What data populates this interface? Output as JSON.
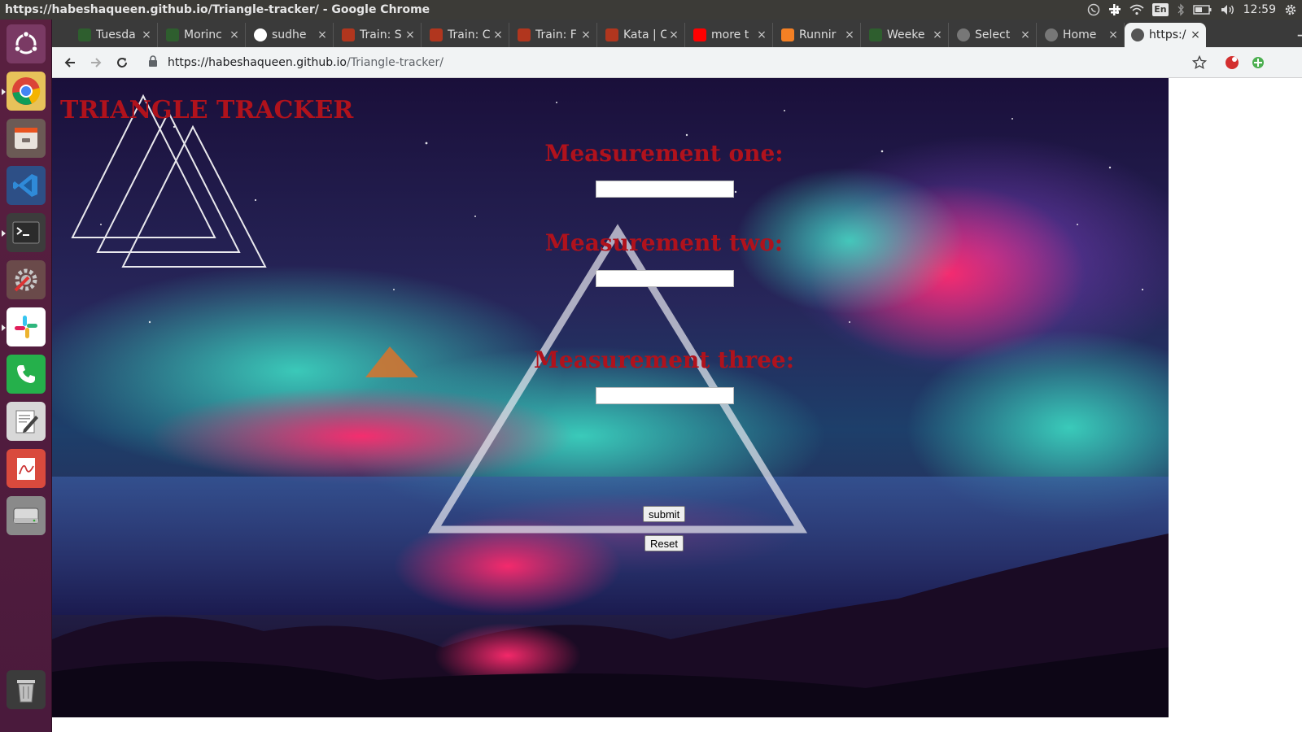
{
  "window": {
    "title": "https://habeshaqueen.github.io/Triangle-tracker/ - Google Chrome",
    "clock": "12:59",
    "keyboard_layout": "En"
  },
  "launcher": [
    {
      "name": "ubuntu-dash",
      "icon": "ubuntu-logo-icon"
    },
    {
      "name": "chrome",
      "icon": "chrome-icon"
    },
    {
      "name": "files",
      "icon": "files-icon"
    },
    {
      "name": "vscode",
      "icon": "vscode-icon"
    },
    {
      "name": "terminal",
      "icon": "terminal-icon"
    },
    {
      "name": "system-settings",
      "icon": "settings-icon"
    },
    {
      "name": "slack",
      "icon": "slack-icon"
    },
    {
      "name": "phone",
      "icon": "phone-icon"
    },
    {
      "name": "text-editor",
      "icon": "text-editor-icon"
    },
    {
      "name": "pdf-reader",
      "icon": "pdf-icon"
    },
    {
      "name": "disk",
      "icon": "disk-icon"
    },
    {
      "name": "trash",
      "icon": "trash-icon"
    }
  ],
  "tabs": [
    {
      "label": "Tuesda",
      "favicon_color": "#2e5e2e"
    },
    {
      "label": "Morinc",
      "favicon_color": "#2e5e2e"
    },
    {
      "label": "sudhe",
      "favicon_color": "#ffffff"
    },
    {
      "label": "Train: S",
      "favicon_color": "#b1361e"
    },
    {
      "label": "Train: C",
      "favicon_color": "#b1361e"
    },
    {
      "label": "Train: F",
      "favicon_color": "#b1361e"
    },
    {
      "label": "Kata | C",
      "favicon_color": "#b1361e"
    },
    {
      "label": "more t",
      "favicon_color": "#ff0000"
    },
    {
      "label": "Runnir",
      "favicon_color": "#f48024"
    },
    {
      "label": "Weeke",
      "favicon_color": "#2e5e2e"
    },
    {
      "label": "Select",
      "favicon_color": "#777777"
    },
    {
      "label": "Home",
      "favicon_color": "#777777"
    },
    {
      "label": "https:/",
      "favicon_color": "#555555",
      "active": true
    }
  ],
  "address_bar": {
    "host": "https://habeshaqueen.github.io",
    "path": "/Triangle-tracker/"
  },
  "page": {
    "title": "TRIANGLE TRACKER",
    "measurement_one": "Measurement one:",
    "measurement_two": "Measurement two:",
    "measurement_three": "Measurement three:",
    "input_one_value": "",
    "input_two_value": "",
    "input_three_value": "",
    "submit_label": "submit",
    "reset_label": "Reset"
  },
  "colors": {
    "title_red": "#b0121c",
    "panel": "#3c3b37",
    "launcher": "#4a1a3c"
  }
}
